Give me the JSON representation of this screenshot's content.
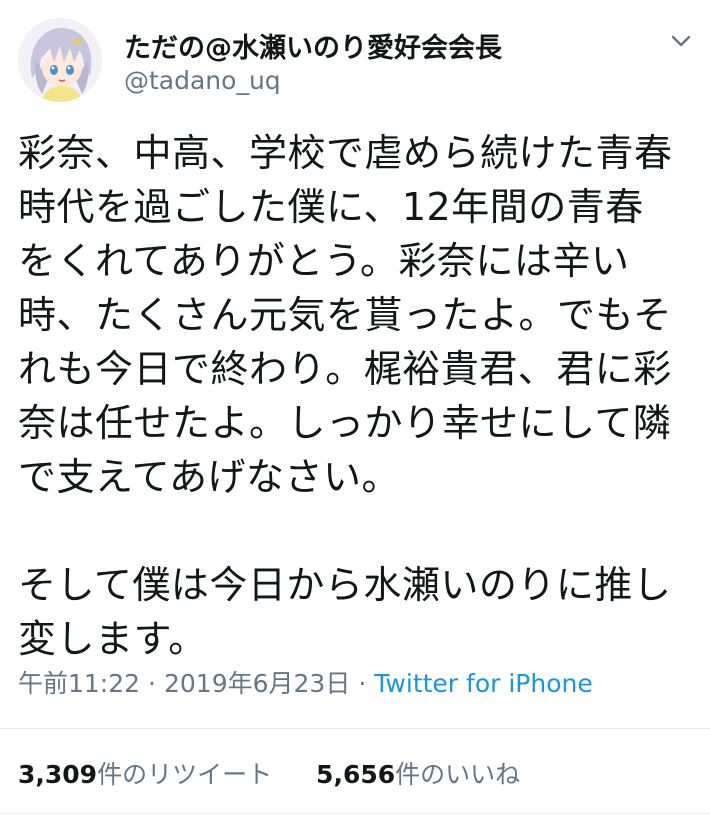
{
  "tweet": {
    "display_name": "ただの@水瀬いのり愛好会会長",
    "handle": "@tadano_uq",
    "avatar_icon": "avatar-anime-character-icon",
    "caret_icon": "chevron-down-icon",
    "body": "彩奈、中高、学校で虐めら続けた青春\n時代を過ごした僕に、12年間の青春\nをくれてありがとう。彩奈には辛い\n時、たくさん元気を貰ったよ。でもそ\nれも今日で終わり。梶裕貴君、君に彩\n奈は任せたよ。しっかり幸せにして隣\nで支えてあげなさい。\n\nそして僕は今日から水瀬いのりに推し\n変します。",
    "time": "午前11:22",
    "separator": "·",
    "date": "2019年6月23日",
    "source": "Twitter for iPhone",
    "retweets": {
      "count": "3,309",
      "label": "件のリツイート"
    },
    "likes": {
      "count": "5,656",
      "label": "件のいいね"
    }
  },
  "colors": {
    "text": "#14171a",
    "secondary": "#657786",
    "link": "#1b95e0",
    "divider": "#e6ecf0"
  }
}
